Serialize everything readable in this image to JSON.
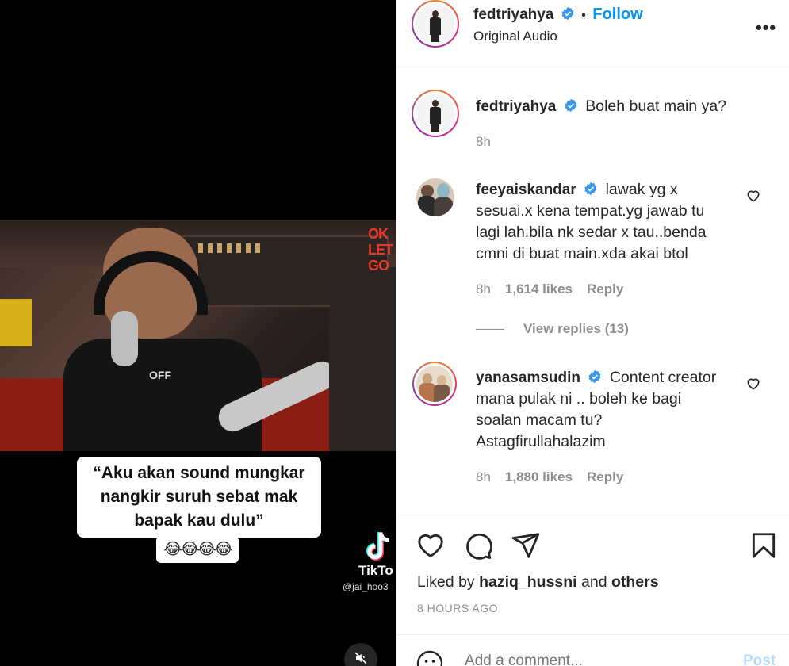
{
  "post": {
    "username": "fedtriyahya",
    "audio": "Original Audio",
    "follow_label": "Follow",
    "separator": "•"
  },
  "video": {
    "caption_lines": [
      "“Aku akan sound mungkar",
      "nangkir suruh sebat mak",
      "bapak kau dulu”"
    ],
    "caption_emoji": "😂😂😂😂",
    "shirt_text": "OFF",
    "sign_text": [
      "OK",
      "LET",
      "GO"
    ],
    "tiktok_brand": "TikTo",
    "tiktok_handle": "@jai_hoo3",
    "mute_icon": "speaker-muted-icon"
  },
  "comments": [
    {
      "username": "fedtriyahya",
      "text": "Boleh buat main ya?",
      "time": "8h"
    },
    {
      "username": "feeyaiskandar",
      "text_lines": [
        "lawak yg x",
        "sesuai.x kena tempat.yg jawab tu",
        "lagi lah.bila nk sedar x tau..benda",
        "cmni di buat main.xda akai btol"
      ],
      "time": "8h",
      "likes": "1,614 likes",
      "reply": "Reply",
      "view_replies": "View replies (13)"
    },
    {
      "username": "yanasamsudin",
      "text_lines": [
        "Content creator",
        "mana pulak ni .. boleh ke bagi",
        "soalan macam tu?",
        "Astagfirullahalazim"
      ],
      "time": "8h",
      "likes": "1,880 likes",
      "reply": "Reply"
    }
  ],
  "actions": {
    "liked_prefix": "Liked by",
    "liked_user": "haziq_hussni",
    "liked_and": "and",
    "liked_others": "others",
    "timestamp": "8 HOURS AGO"
  },
  "add_comment": {
    "placeholder": "Add a comment...",
    "post_label": "Post"
  },
  "colors": {
    "accent": "#0095f6",
    "verified": "#3897f0",
    "muted_text": "#8e8e8e",
    "post_disabled": "#b3dbff"
  }
}
